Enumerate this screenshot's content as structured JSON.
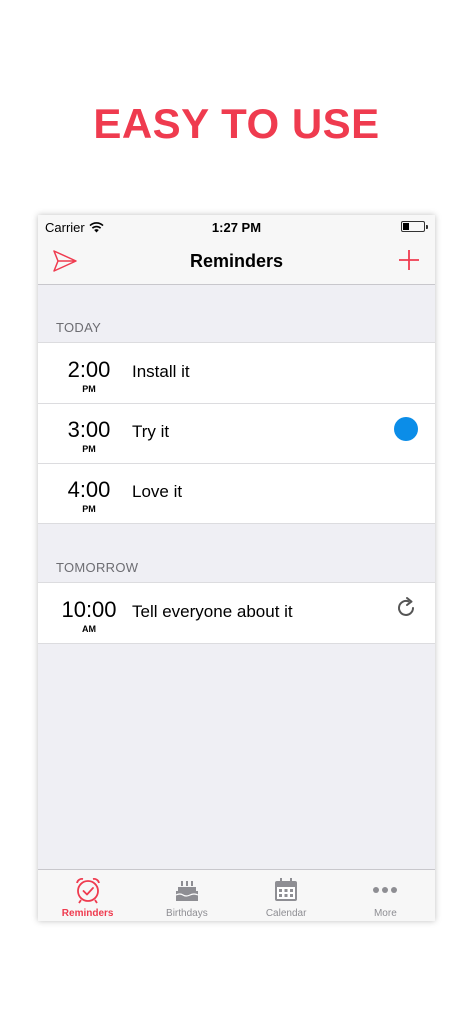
{
  "headline": "EASY TO USE",
  "status": {
    "carrier": "Carrier",
    "time": "1:27 PM"
  },
  "nav": {
    "title": "Reminders"
  },
  "sections": [
    {
      "header": "TODAY",
      "rows": [
        {
          "time": "2:00",
          "ampm": "PM",
          "label": "Install it"
        },
        {
          "time": "3:00",
          "ampm": "PM",
          "label": "Try it"
        },
        {
          "time": "4:00",
          "ampm": "PM",
          "label": "Love it"
        }
      ]
    },
    {
      "header": "TOMORROW",
      "rows": [
        {
          "time": "10:00",
          "ampm": "AM",
          "label": "Tell everyone about it"
        }
      ]
    }
  ],
  "tabs": [
    {
      "label": "Reminders",
      "icon": "alarm-clock-icon"
    },
    {
      "label": "Birthdays",
      "icon": "cake-icon"
    },
    {
      "label": "Calendar",
      "icon": "calendar-icon"
    },
    {
      "label": "More",
      "icon": "more-dots-icon"
    }
  ],
  "colors": {
    "accent": "#ef3b4f",
    "dot": "#0b8de8",
    "background": "#efeff4",
    "inactive": "#8e8e93"
  }
}
